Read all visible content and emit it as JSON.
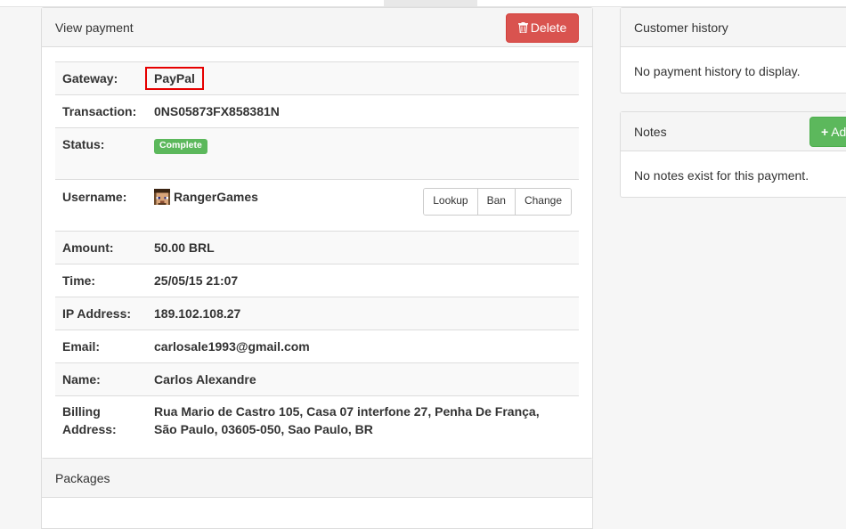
{
  "view_payment": {
    "title": "View payment",
    "delete_label": "Delete",
    "rows": {
      "gateway": {
        "label": "Gateway:",
        "value": "PayPal"
      },
      "transaction": {
        "label": "Transaction:",
        "value": "0NS05873FX858381N"
      },
      "status": {
        "label": "Status:",
        "value": "Complete"
      },
      "username": {
        "label": "Username:",
        "value": "RangerGames"
      },
      "amount": {
        "label": "Amount:",
        "value": "50.00 BRL"
      },
      "time": {
        "label": "Time:",
        "value": "25/05/15 21:07"
      },
      "ip": {
        "label": "IP Address:",
        "value": "189.102.108.27"
      },
      "email": {
        "label": "Email:",
        "value": "carlosale1993@gmail.com"
      },
      "name": {
        "label": "Name:",
        "value": "Carlos Alexandre"
      },
      "billing": {
        "label_line1": "Billing",
        "label_line2": "Address:",
        "value_line1": "Rua Mario de Castro 105, Casa 07 interfone 27, Penha De França,",
        "value_line2": "São Paulo, 03605-050, Sao Paulo, BR"
      }
    },
    "user_actions": {
      "lookup": "Lookup",
      "ban": "Ban",
      "change": "Change"
    }
  },
  "packages": {
    "title": "Packages"
  },
  "customer_history": {
    "title": "Customer history",
    "empty_text": "No payment history to display."
  },
  "notes": {
    "title": "Notes",
    "add_label": "Ad",
    "empty_text": "No notes exist for this payment."
  },
  "colors": {
    "danger": "#d9534f",
    "success": "#5cb85c",
    "highlight": "#e60000"
  },
  "icons": {
    "delete": "trash-icon",
    "add": "plus-icon",
    "user": "player-head-avatar"
  }
}
